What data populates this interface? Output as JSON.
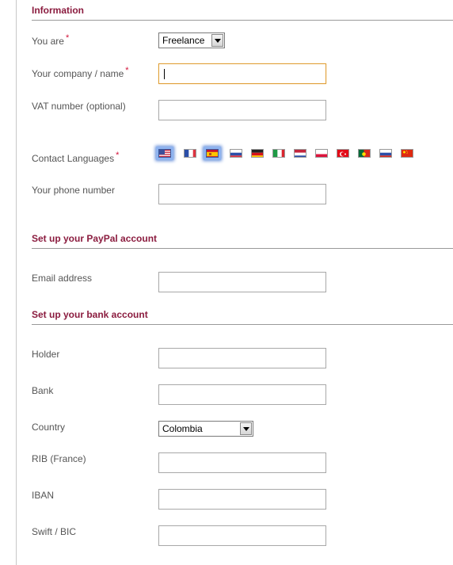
{
  "information": {
    "title": "Information",
    "you_are": {
      "label": "You are",
      "value": "Freelance"
    },
    "company": {
      "label": "Your company / name",
      "value": ""
    },
    "vat": {
      "label": "VAT number (optional)",
      "value": ""
    },
    "contact_languages": {
      "label": "Contact Languages",
      "flags": [
        {
          "name": "us-flag-icon",
          "selected": true
        },
        {
          "name": "france-flag-icon",
          "selected": false
        },
        {
          "name": "spain-flag-icon",
          "selected": true
        },
        {
          "name": "french-flag-alt-icon",
          "selected": false
        },
        {
          "name": "germany-flag-icon",
          "selected": false
        },
        {
          "name": "italy-flag-icon",
          "selected": false
        },
        {
          "name": "netherlands-flag-icon",
          "selected": false
        },
        {
          "name": "poland-flag-icon",
          "selected": false
        },
        {
          "name": "turkey-flag-icon",
          "selected": false
        },
        {
          "name": "portugal-flag-icon",
          "selected": false
        },
        {
          "name": "russia-flag-icon",
          "selected": false
        },
        {
          "name": "china-flag-icon",
          "selected": false
        }
      ]
    },
    "phone": {
      "label": "Your phone number",
      "value": ""
    }
  },
  "paypal": {
    "title": "Set up your PayPal account",
    "email": {
      "label": "Email address",
      "value": ""
    }
  },
  "bank": {
    "title": "Set up your bank account",
    "holder": {
      "label": "Holder",
      "value": ""
    },
    "bank": {
      "label": "Bank",
      "value": ""
    },
    "country": {
      "label": "Country",
      "value": "Colombia"
    },
    "rib": {
      "label": "RIB (France)",
      "value": ""
    },
    "iban": {
      "label": "IBAN",
      "value": ""
    },
    "swift": {
      "label": "Swift / BIC",
      "value": ""
    }
  },
  "required_marker": "*",
  "colors": {
    "section_title": "#8b1c3f",
    "required": "#d2143a",
    "focus_border": "#e0a03a"
  }
}
